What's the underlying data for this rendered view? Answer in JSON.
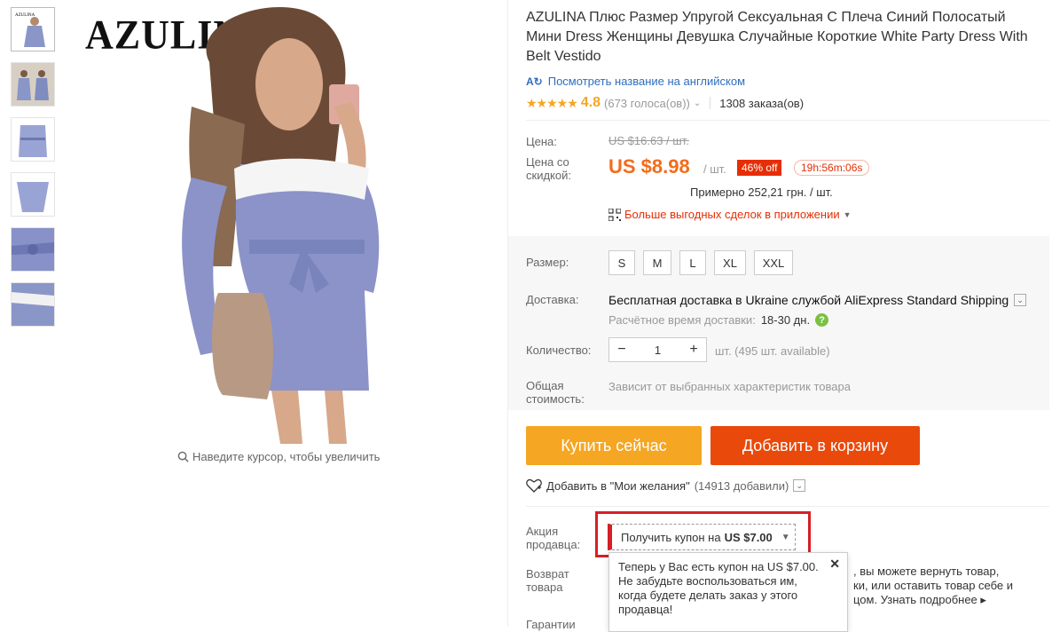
{
  "gallery": {
    "thumbnails": [
      "thumb-1",
      "thumb-2",
      "thumb-3",
      "thumb-4",
      "thumb-5",
      "thumb-6"
    ],
    "brand_logo": "AZULINA",
    "zoom_hint": "Наведите курсор, чтобы увеличить"
  },
  "product": {
    "title": "AZULINA Плюс Размер Упругой Сексуальная С Плеча Синий Полосатый Мини Dress Женщины Девушка Случайные Короткие White Party Dress With Belt Vestido",
    "translate_link": "Посмотреть название на английском",
    "stars": "★★★★★",
    "rating": "4.8",
    "votes": "(673 голоса(ов))",
    "orders": "1308 заказа(ов)"
  },
  "price": {
    "label_price": "Цена:",
    "old_price": "US $16.63 / шт.",
    "label_discount": "Цена со скидкой:",
    "new_price": "US $8.98",
    "per_unit": "/ шт.",
    "discount": "46% off",
    "timer": "19h:56m:06s",
    "approx": "Примерно 252,21 грн. / шт.",
    "app_deals": "Больше выгодных сделок в приложении"
  },
  "options": {
    "size_label": "Размер:",
    "sizes": [
      "S",
      "M",
      "L",
      "XL",
      "XXL"
    ],
    "shipping_label": "Доставка:",
    "shipping_main": "Бесплатная доставка в Ukraine службой AliExpress Standard Shipping",
    "shipping_est": "Расчётное время доставки:",
    "shipping_days": "18-30 дн.",
    "qty_label": "Количество:",
    "qty_value": "1",
    "qty_note": "шт. (495 шт. available)",
    "total_label": "Общая стоимость:",
    "total_note": "Зависит от выбранных характеристик товара"
  },
  "actions": {
    "buy_now": "Купить сейчас",
    "add_to_cart": "Добавить в корзину",
    "wishlist": "Добавить в \"Мои желания\"",
    "wishlist_count": "(14913 добавили)"
  },
  "promo": {
    "label": "Акция продавца:",
    "coupon_text": "Получить купон на",
    "coupon_amount": "US $7.00",
    "return_label": "Возврат товара",
    "return_text_1": ", вы можете вернуть товар,",
    "return_text_2": "ки, или оставить товар себе и",
    "return_text_3": "цом.",
    "learn_more": "Узнать подробнее ▸",
    "guarantee_label": "Гарантии",
    "tooltip": "Теперь у Вас есть купон на US $7.00. Не забудьте воспользоваться им, когда будете делать заказ у этого продавца!"
  },
  "colors": {
    "accent_orange": "#f5a623",
    "cart_red": "#e9490b",
    "price_orange": "#f36c1a",
    "badge_red": "#e62e04",
    "highlight_red": "#d61f26"
  }
}
